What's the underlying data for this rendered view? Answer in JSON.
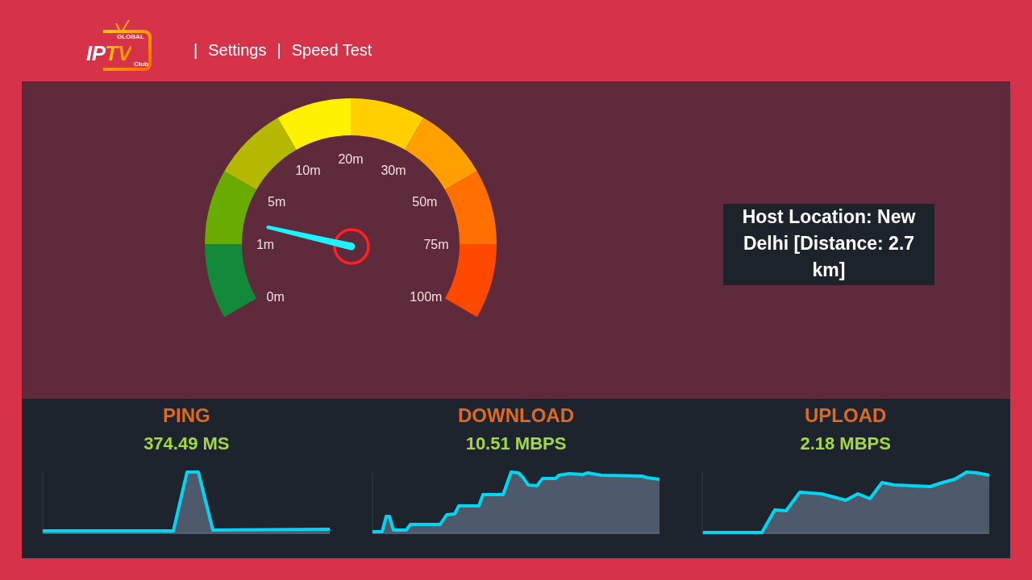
{
  "header": {
    "logo": {
      "top_text": "GLOBAL",
      "brand": "IPTV",
      "bottom_text": "Club"
    },
    "nav": [
      {
        "separator": "|",
        "label": "Settings"
      },
      {
        "separator": "|",
        "label": "Speed Test"
      }
    ]
  },
  "gauge": {
    "ticks": [
      "0m",
      "1m",
      "5m",
      "10m",
      "20m",
      "30m",
      "50m",
      "75m",
      "100m"
    ]
  },
  "host": {
    "text": "Host Location: New Delhi [Distance: 2.7 km]"
  },
  "stats": [
    {
      "label": "PING",
      "value": "374.49 MS"
    },
    {
      "label": "DOWNLOAD",
      "value": "10.51 MBPS"
    },
    {
      "label": "UPLOAD",
      "value": "2.18 MBPS"
    }
  ]
}
